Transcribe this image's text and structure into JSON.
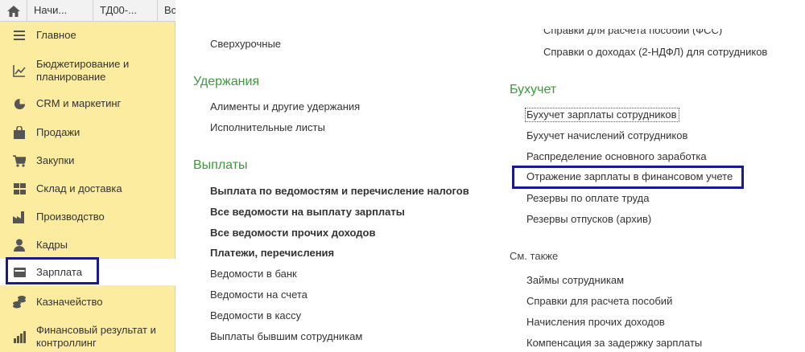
{
  "tabs": {
    "home_icon": "home-icon",
    "items": [
      "Начи...",
      "ТД00-...",
      "Вс"
    ]
  },
  "sidebar": {
    "items": [
      {
        "label": "Главное",
        "icon": "menu-lines-icon"
      },
      {
        "label": "Бюджетирование и планирование",
        "icon": "chart-icon"
      },
      {
        "label": "CRM и маркетинг",
        "icon": "pie-icon"
      },
      {
        "label": "Продажи",
        "icon": "bag-icon"
      },
      {
        "label": "Закупки",
        "icon": "cart-icon"
      },
      {
        "label": "Склад и доставка",
        "icon": "grid-icon"
      },
      {
        "label": "Производство",
        "icon": "factory-icon"
      },
      {
        "label": "Кадры",
        "icon": "person-icon"
      },
      {
        "label": "Зарплата",
        "icon": "wallet-icon",
        "active": true
      },
      {
        "label": "Казначейство",
        "icon": "coins-icon"
      },
      {
        "label": "Финансовый результат и контроллинг",
        "icon": "bars-icon"
      }
    ]
  },
  "col1": {
    "top_link": "Сверхурочные",
    "deductions": {
      "title": "Удержания",
      "links": [
        "Алименты и другие удержания",
        "Исполнительные листы"
      ]
    },
    "payments": {
      "title": "Выплаты",
      "bold_links": [
        "Выплата по ведомостям и перечисление налогов",
        "Все ведомости на выплату зарплаты",
        "Все ведомости прочих доходов",
        "Платежи, перечисления"
      ],
      "links": [
        "Ведомости в банк",
        "Ведомости на счета",
        "Ведомости в кассу",
        "Выплаты бывшим сотрудникам"
      ]
    }
  },
  "col2": {
    "cut_link": "Справки для расчета пособий (ФСС)",
    "top_link": "Справки о доходах (2-НДФЛ) для сотрудников",
    "accounting": {
      "title": "Бухучет",
      "links": [
        "Бухучет зарплаты сотрудников",
        "Бухучет начислений сотрудников",
        "Распределение основного заработка",
        "Отражение зарплаты в финансовом учете",
        "Резервы по оплате труда",
        "Резервы отпусков (архив)"
      ]
    },
    "see_also": {
      "title": "См. также",
      "links": [
        "Займы сотрудникам",
        "Справки для расчета пособий",
        "Начисления прочих доходов",
        "Компенсация за задержку зарплаты"
      ]
    }
  },
  "colors": {
    "sidebar_bg": "#fbeca0",
    "section_green": "#3a9a3a",
    "highlight_navy": "#1a1a8c"
  }
}
